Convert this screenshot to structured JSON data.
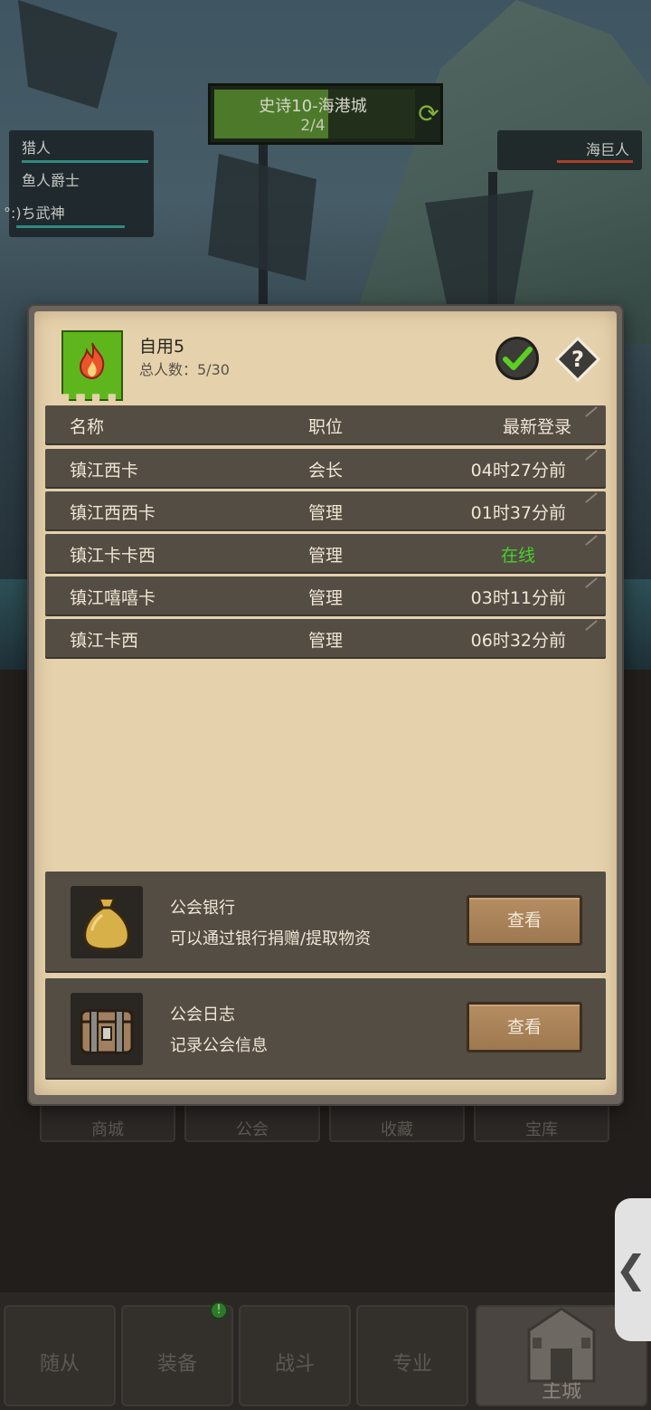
{
  "dungeon": {
    "title": "史诗10-海港城",
    "progress": "2/4",
    "progress_fraction": 0.5
  },
  "party": [
    {
      "name": "猎人",
      "hp": 1.0
    },
    {
      "name": "鱼人爵士",
      "hp": 0.0
    },
    {
      "name": "°:)ち武神",
      "hp": 0.85
    }
  ],
  "enemy": {
    "name": "海巨人",
    "hp": 0.6
  },
  "guild": {
    "name": "自用5",
    "member_count": "总人数：5/30",
    "table": {
      "headers": {
        "name": "名称",
        "role": "职位",
        "last_login": "最新登录"
      },
      "rows": [
        {
          "name": "镇江西卡",
          "role": "会长",
          "last_login": "04时27分前",
          "online": false
        },
        {
          "name": "镇江西西卡",
          "role": "管理",
          "last_login": "01时37分前",
          "online": false
        },
        {
          "name": "镇江卡卡西",
          "role": "管理",
          "last_login": "在线",
          "online": true
        },
        {
          "name": "镇江嘻嘻卡",
          "role": "管理",
          "last_login": "03时11分前",
          "online": false
        },
        {
          "name": "镇江卡西",
          "role": "管理",
          "last_login": "06时32分前",
          "online": false
        }
      ]
    },
    "bank": {
      "title": "公会银行",
      "desc": "可以通过银行捐赠/提取物资",
      "button": "查看",
      "icon": "money-bag-icon"
    },
    "log": {
      "title": "公会日志",
      "desc": "记录公会信息",
      "button": "查看",
      "icon": "treasure-chest-icon"
    }
  },
  "subtabs": [
    "商城",
    "公会",
    "收藏",
    "宝库"
  ],
  "bottom_nav": [
    "随从",
    "装备",
    "战斗",
    "专业",
    "主城"
  ],
  "colors": {
    "online": "#46d12a",
    "guild_flag": "#5fb61c",
    "parchment": "#e5d2ac",
    "row": "#544d44"
  }
}
